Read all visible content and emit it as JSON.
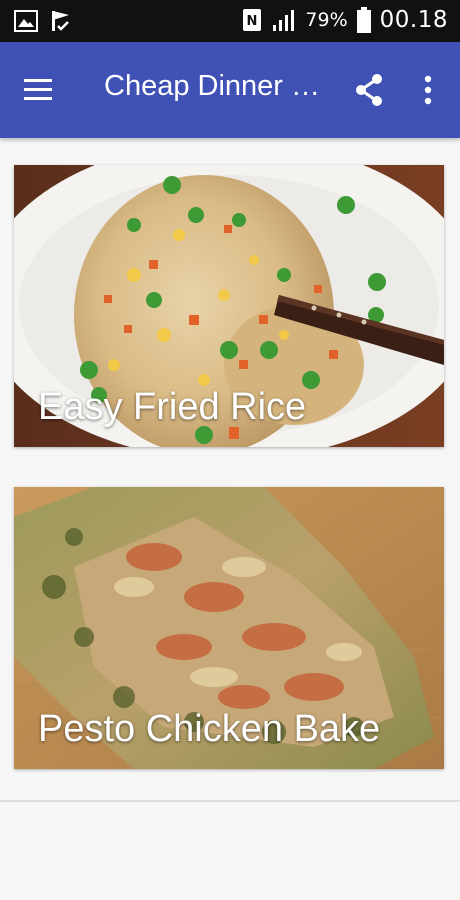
{
  "status_bar": {
    "icons": [
      "image-icon",
      "flag-check-icon",
      "nfc-icon",
      "signal-icon",
      "battery-icon"
    ],
    "battery_percent": "79%",
    "time": "00.18"
  },
  "app_bar": {
    "title": "Cheap Dinner R...",
    "color": "#3f51b5",
    "icons": [
      "hamburger-menu-icon",
      "share-icon",
      "more-vert-icon"
    ]
  },
  "recipes": [
    {
      "title": "Easy Fried Rice"
    },
    {
      "title": "Pesto Chicken Bake"
    }
  ]
}
